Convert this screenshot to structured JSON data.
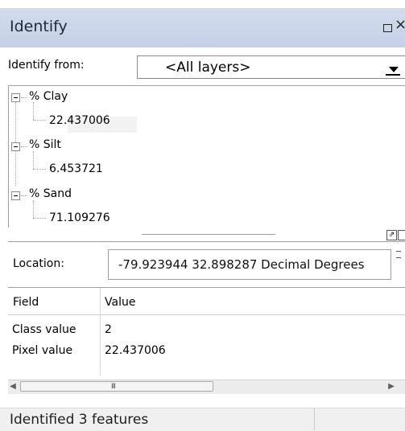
{
  "window": {
    "title": "Identify",
    "restore_icon": "restore-icon",
    "close_icon": "close-icon",
    "close_glyph": "×"
  },
  "identify_from": {
    "label": "Identify from:",
    "selected": "<All layers>"
  },
  "tree": [
    {
      "layer": "% Clay",
      "value": "22.437006"
    },
    {
      "layer": "% Silt",
      "value": "6.453721"
    },
    {
      "layer": "% Sand",
      "value": "71.109276"
    }
  ],
  "location": {
    "label": "Location:",
    "value": "-79.923944  32.898287 Decimal Degrees"
  },
  "table": {
    "headers": [
      "Field",
      "Value"
    ],
    "rows": [
      [
        "Class value",
        "2"
      ],
      [
        "Pixel value",
        "22.437006"
      ]
    ]
  },
  "scrollbar": {
    "left_arrow": "◀",
    "right_arrow": "▶",
    "thumb_grip": "III"
  },
  "status": {
    "text": "Identified 3 features"
  },
  "colors": {
    "titlebar": "#c9d4e9",
    "status_bar": "#f0f0f0",
    "selection": "#f2f2f2"
  }
}
